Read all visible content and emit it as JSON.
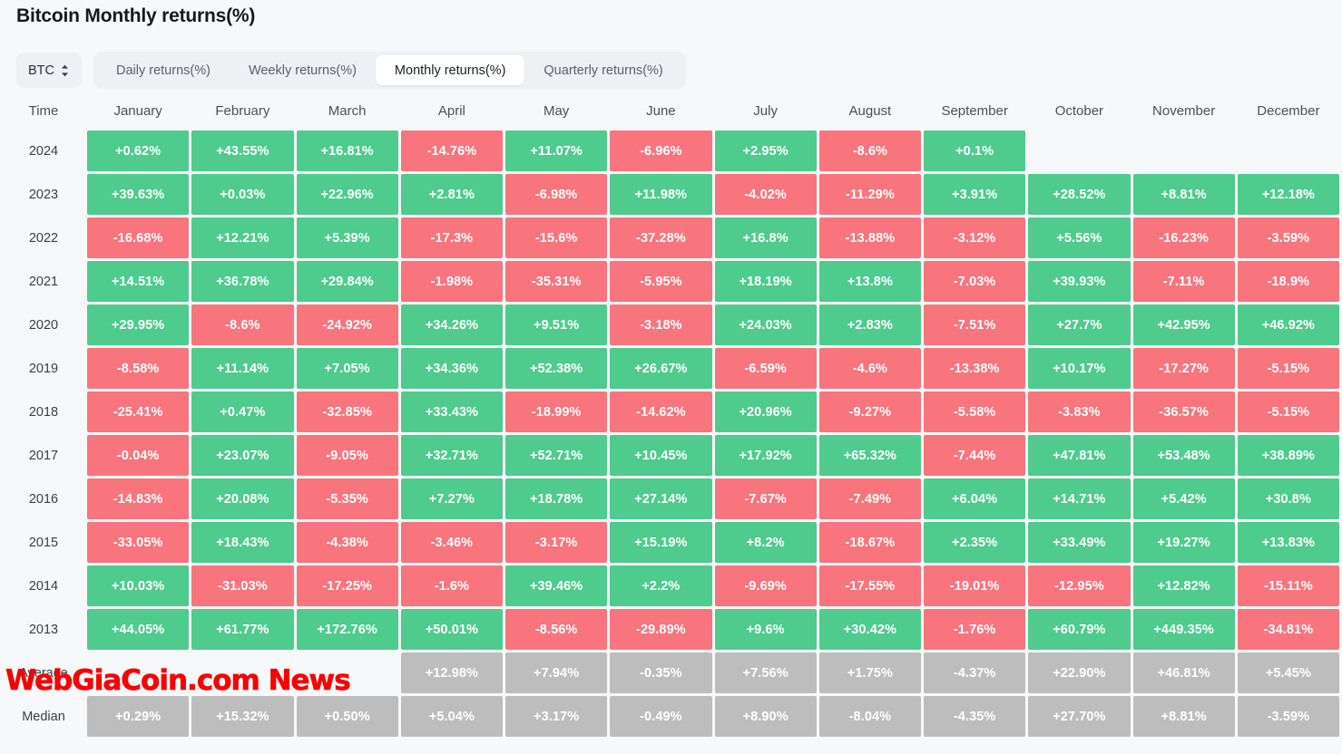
{
  "page_title": "Bitcoin Monthly returns(%)",
  "controls": {
    "coin_selector": {
      "label": "BTC",
      "icon": "chevron-up-down-icon"
    },
    "tabs": [
      {
        "label": "Daily returns(%)",
        "active": false
      },
      {
        "label": "Weekly returns(%)",
        "active": false
      },
      {
        "label": "Monthly returns(%)",
        "active": true
      },
      {
        "label": "Quarterly returns(%)",
        "active": false
      }
    ]
  },
  "watermark": "WebGiaCoin.com News",
  "colors": {
    "positive": "#4ecb8d",
    "negative": "#f8757d",
    "neutral": "#bdbdbd",
    "background": "#f7f8f9",
    "watermark": "#f70000"
  },
  "chart_data": {
    "type": "heatmap",
    "title": "Bitcoin Monthly returns(%)",
    "xlabel": "",
    "ylabel": "Time",
    "columns": [
      "Time",
      "January",
      "February",
      "March",
      "April",
      "May",
      "June",
      "July",
      "August",
      "September",
      "October",
      "November",
      "December"
    ],
    "categories": [
      "January",
      "February",
      "March",
      "April",
      "May",
      "June",
      "July",
      "August",
      "September",
      "October",
      "November",
      "December"
    ],
    "rows": [
      {
        "label": "2024",
        "kind": "year",
        "values": [
          "+0.62%",
          "+43.55%",
          "+16.81%",
          "-14.76%",
          "+11.07%",
          "-6.96%",
          "+2.95%",
          "-8.6%",
          "+0.1%",
          "",
          "",
          ""
        ]
      },
      {
        "label": "2023",
        "kind": "year",
        "values": [
          "+39.63%",
          "+0.03%",
          "+22.96%",
          "+2.81%",
          "-6.98%",
          "+11.98%",
          "-4.02%",
          "-11.29%",
          "+3.91%",
          "+28.52%",
          "+8.81%",
          "+12.18%"
        ]
      },
      {
        "label": "2022",
        "kind": "year",
        "values": [
          "-16.68%",
          "+12.21%",
          "+5.39%",
          "-17.3%",
          "-15.6%",
          "-37.28%",
          "+16.8%",
          "-13.88%",
          "-3.12%",
          "+5.56%",
          "-16.23%",
          "-3.59%"
        ]
      },
      {
        "label": "2021",
        "kind": "year",
        "values": [
          "+14.51%",
          "+36.78%",
          "+29.84%",
          "-1.98%",
          "-35.31%",
          "-5.95%",
          "+18.19%",
          "+13.8%",
          "-7.03%",
          "+39.93%",
          "-7.11%",
          "-18.9%"
        ]
      },
      {
        "label": "2020",
        "kind": "year",
        "values": [
          "+29.95%",
          "-8.6%",
          "-24.92%",
          "+34.26%",
          "+9.51%",
          "-3.18%",
          "+24.03%",
          "+2.83%",
          "-7.51%",
          "+27.7%",
          "+42.95%",
          "+46.92%"
        ]
      },
      {
        "label": "2019",
        "kind": "year",
        "values": [
          "-8.58%",
          "+11.14%",
          "+7.05%",
          "+34.36%",
          "+52.38%",
          "+26.67%",
          "-6.59%",
          "-4.6%",
          "-13.38%",
          "+10.17%",
          "-17.27%",
          "-5.15%"
        ]
      },
      {
        "label": "2018",
        "kind": "year",
        "values": [
          "-25.41%",
          "+0.47%",
          "-32.85%",
          "+33.43%",
          "-18.99%",
          "-14.62%",
          "+20.96%",
          "-9.27%",
          "-5.58%",
          "-3.83%",
          "-36.57%",
          "-5.15%"
        ]
      },
      {
        "label": "2017",
        "kind": "year",
        "values": [
          "-0.04%",
          "+23.07%",
          "-9.05%",
          "+32.71%",
          "+52.71%",
          "+10.45%",
          "+17.92%",
          "+65.32%",
          "-7.44%",
          "+47.81%",
          "+53.48%",
          "+38.89%"
        ]
      },
      {
        "label": "2016",
        "kind": "year",
        "values": [
          "-14.83%",
          "+20.08%",
          "-5.35%",
          "+7.27%",
          "+18.78%",
          "+27.14%",
          "-7.67%",
          "-7.49%",
          "+6.04%",
          "+14.71%",
          "+5.42%",
          "+30.8%"
        ]
      },
      {
        "label": "2015",
        "kind": "year",
        "values": [
          "-33.05%",
          "+18.43%",
          "-4.38%",
          "-3.46%",
          "-3.17%",
          "+15.19%",
          "+8.2%",
          "-18.67%",
          "+2.35%",
          "+33.49%",
          "+19.27%",
          "+13.83%"
        ]
      },
      {
        "label": "2014",
        "kind": "year",
        "values": [
          "+10.03%",
          "-31.03%",
          "-17.25%",
          "-1.6%",
          "+39.46%",
          "+2.2%",
          "-9.69%",
          "-17.55%",
          "-19.01%",
          "-12.95%",
          "+12.82%",
          "-15.11%"
        ]
      },
      {
        "label": "2013",
        "kind": "year",
        "values": [
          "+44.05%",
          "+61.77%",
          "+172.76%",
          "+50.01%",
          "-8.56%",
          "-29.89%",
          "+9.6%",
          "+30.42%",
          "-1.76%",
          "+60.79%",
          "+449.35%",
          "-34.81%"
        ]
      },
      {
        "label": "Average",
        "kind": "summary",
        "values": [
          "",
          "",
          "",
          "+12.98%",
          "+7.94%",
          "-0.35%",
          "+7.56%",
          "+1.75%",
          "-4.37%",
          "+22.90%",
          "+46.81%",
          "+5.45%"
        ]
      },
      {
        "label": "Median",
        "kind": "summary",
        "values": [
          "+0.29%",
          "+15.32%",
          "+0.50%",
          "+5.04%",
          "+3.17%",
          "-0.49%",
          "+8.90%",
          "-8.04%",
          "-4.35%",
          "+27.70%",
          "+8.81%",
          "-3.59%"
        ]
      }
    ]
  }
}
